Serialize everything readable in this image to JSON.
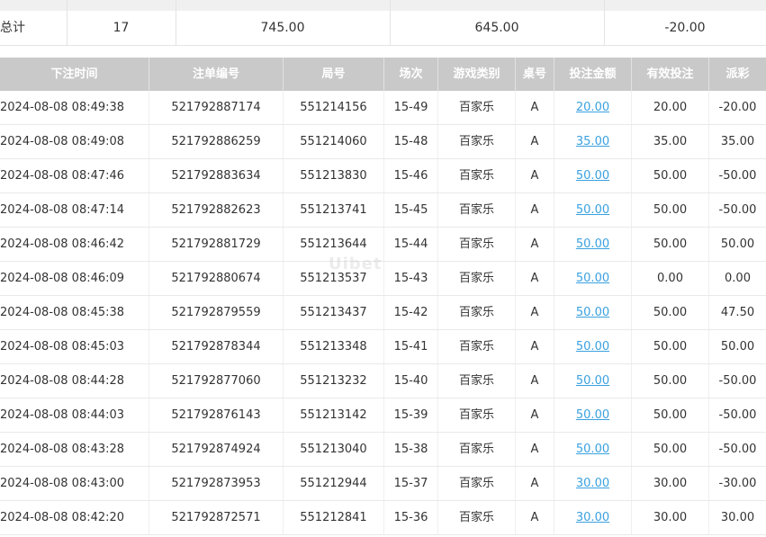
{
  "summary": {
    "label": "总计",
    "count": "17",
    "bet_total": "745.00",
    "valid_total": "645.00",
    "payout_total": "-20.00"
  },
  "headers": {
    "time": "下注时间",
    "order_no": "注单编号",
    "round_no": "局号",
    "session": "场次",
    "game_type": "游戏类别",
    "table": "桌号",
    "bet_amount": "投注金额",
    "valid_bet": "有效投注",
    "payout": "派彩"
  },
  "watermark": "Uibet",
  "colors": {
    "negative": "#e8403c",
    "link": "#3aa1e0",
    "header_bg": "#c9c9c9"
  },
  "rows": [
    {
      "time": "2024-08-08 08:49:38",
      "order_no": "521792887174",
      "round_no": "551214156",
      "session": "15-49",
      "game_type": "百家乐",
      "table": "A",
      "bet_amount": "20.00",
      "valid_bet": "20.00",
      "payout": "-20.00",
      "neg": true
    },
    {
      "time": "2024-08-08 08:49:08",
      "order_no": "521792886259",
      "round_no": "551214060",
      "session": "15-48",
      "game_type": "百家乐",
      "table": "A",
      "bet_amount": "35.00",
      "valid_bet": "35.00",
      "payout": "35.00",
      "neg": false
    },
    {
      "time": "2024-08-08 08:47:46",
      "order_no": "521792883634",
      "round_no": "551213830",
      "session": "15-46",
      "game_type": "百家乐",
      "table": "A",
      "bet_amount": "50.00",
      "valid_bet": "50.00",
      "payout": "-50.00",
      "neg": true
    },
    {
      "time": "2024-08-08 08:47:14",
      "order_no": "521792882623",
      "round_no": "551213741",
      "session": "15-45",
      "game_type": "百家乐",
      "table": "A",
      "bet_amount": "50.00",
      "valid_bet": "50.00",
      "payout": "-50.00",
      "neg": true
    },
    {
      "time": "2024-08-08 08:46:42",
      "order_no": "521792881729",
      "round_no": "551213644",
      "session": "15-44",
      "game_type": "百家乐",
      "table": "A",
      "bet_amount": "50.00",
      "valid_bet": "50.00",
      "payout": "50.00",
      "neg": false
    },
    {
      "time": "2024-08-08 08:46:09",
      "order_no": "521792880674",
      "round_no": "551213537",
      "session": "15-43",
      "game_type": "百家乐",
      "table": "A",
      "bet_amount": "50.00",
      "valid_bet": "0.00",
      "payout": "0.00",
      "neg": false
    },
    {
      "time": "2024-08-08 08:45:38",
      "order_no": "521792879559",
      "round_no": "551213437",
      "session": "15-42",
      "game_type": "百家乐",
      "table": "A",
      "bet_amount": "50.00",
      "valid_bet": "50.00",
      "payout": "47.50",
      "neg": false
    },
    {
      "time": "2024-08-08 08:45:03",
      "order_no": "521792878344",
      "round_no": "551213348",
      "session": "15-41",
      "game_type": "百家乐",
      "table": "A",
      "bet_amount": "50.00",
      "valid_bet": "50.00",
      "payout": "50.00",
      "neg": false
    },
    {
      "time": "2024-08-08 08:44:28",
      "order_no": "521792877060",
      "round_no": "551213232",
      "session": "15-40",
      "game_type": "百家乐",
      "table": "A",
      "bet_amount": "50.00",
      "valid_bet": "50.00",
      "payout": "-50.00",
      "neg": true
    },
    {
      "time": "2024-08-08 08:44:03",
      "order_no": "521792876143",
      "round_no": "551213142",
      "session": "15-39",
      "game_type": "百家乐",
      "table": "A",
      "bet_amount": "50.00",
      "valid_bet": "50.00",
      "payout": "-50.00",
      "neg": true
    },
    {
      "time": "2024-08-08 08:43:28",
      "order_no": "521792874924",
      "round_no": "551213040",
      "session": "15-38",
      "game_type": "百家乐",
      "table": "A",
      "bet_amount": "50.00",
      "valid_bet": "50.00",
      "payout": "-50.00",
      "neg": true
    },
    {
      "time": "2024-08-08 08:43:00",
      "order_no": "521792873953",
      "round_no": "551212944",
      "session": "15-37",
      "game_type": "百家乐",
      "table": "A",
      "bet_amount": "30.00",
      "valid_bet": "30.00",
      "payout": "-30.00",
      "neg": true
    },
    {
      "time": "2024-08-08 08:42:20",
      "order_no": "521792872571",
      "round_no": "551212841",
      "session": "15-36",
      "game_type": "百家乐",
      "table": "A",
      "bet_amount": "30.00",
      "valid_bet": "30.00",
      "payout": "30.00",
      "neg": false
    }
  ]
}
